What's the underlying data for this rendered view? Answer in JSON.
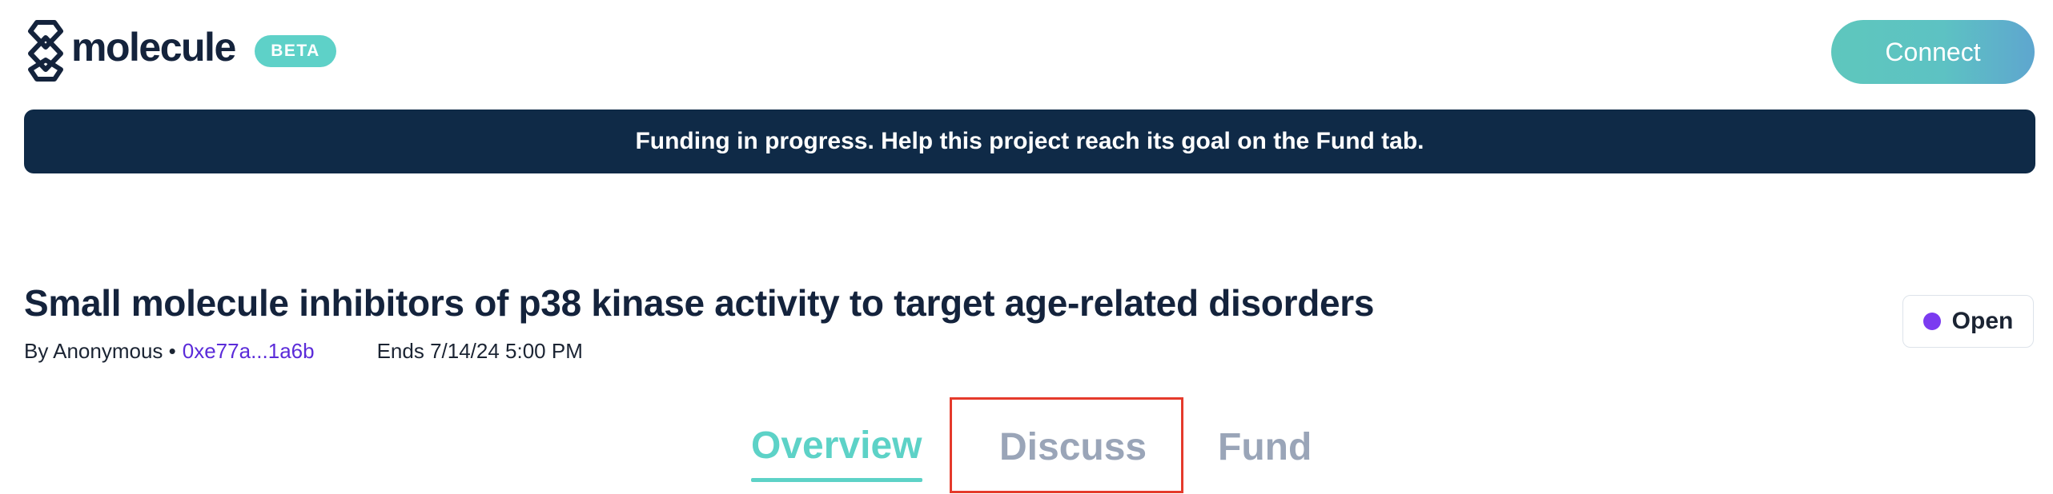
{
  "brand": {
    "name": "molecule",
    "badge": "BETA"
  },
  "header": {
    "connect_label": "Connect"
  },
  "banner": {
    "text": "Funding in progress. Help this project reach its goal on the Fund tab."
  },
  "project": {
    "title": "Small molecule inhibitors of p38 kinase activity to target age-related disorders",
    "by_label": "By Anonymous •",
    "address": "0xe77a...1a6b",
    "ends": "Ends 7/14/24 5:00 PM",
    "status": "Open"
  },
  "tabs": [
    {
      "label": "Overview",
      "active": true
    },
    {
      "label": "Discuss",
      "active": false
    },
    {
      "label": "Fund",
      "active": false
    }
  ],
  "colors": {
    "accent": "#5dd2c7",
    "banner_bg": "#0f2a47",
    "address": "#5b2bd9",
    "status_dot": "#7b3bf0",
    "inactive_tab": "#9aa5b8",
    "highlight_box": "#e53a2b"
  }
}
